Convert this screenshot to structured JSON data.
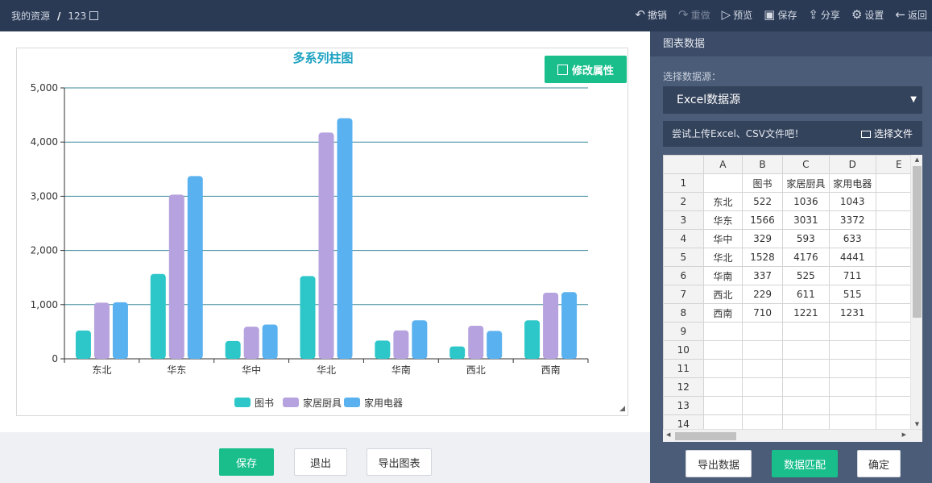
{
  "topbar": {
    "breadcrumb_root": "我的资源",
    "breadcrumb_sep": "/",
    "breadcrumb_item": "123",
    "actions": [
      {
        "label": "撤销",
        "icon": "undo-icon",
        "glyph": "↶",
        "disabled": false
      },
      {
        "label": "重做",
        "icon": "redo-icon",
        "glyph": "↷",
        "disabled": true
      },
      {
        "label": "预览",
        "icon": "play-icon",
        "glyph": "▷",
        "disabled": false
      },
      {
        "label": "保存",
        "icon": "save-icon",
        "glyph": "▣",
        "disabled": false
      },
      {
        "label": "分享",
        "icon": "share-icon",
        "glyph": "⇪",
        "disabled": false
      },
      {
        "label": "设置",
        "icon": "gear-icon",
        "glyph": "⚙",
        "disabled": false
      },
      {
        "label": "返回",
        "icon": "back-arrow-icon",
        "glyph": "←",
        "disabled": false
      }
    ]
  },
  "canvas": {
    "modify_button": "修改属性"
  },
  "chart_data": {
    "type": "bar",
    "title": "多系列柱图",
    "categories": [
      "东北",
      "华东",
      "华中",
      "华北",
      "华南",
      "西北",
      "西南"
    ],
    "series": [
      {
        "name": "图书",
        "color": "#2ec7c9",
        "values": [
          522,
          1566,
          329,
          1528,
          337,
          229,
          710
        ]
      },
      {
        "name": "家居厨具",
        "color": "#b6a2de",
        "values": [
          1036,
          3031,
          593,
          4176,
          525,
          611,
          1221
        ]
      },
      {
        "name": "家用电器",
        "color": "#5ab1ef",
        "values": [
          1043,
          3372,
          633,
          4441,
          711,
          515,
          1231
        ]
      }
    ],
    "ylim": [
      0,
      5000
    ],
    "yticks": [
      "0",
      "1,000",
      "2,000",
      "3,000",
      "4,000",
      "5,000"
    ],
    "grid": true,
    "legend_position": "bottom-center"
  },
  "bottom_bar": {
    "save": "保存",
    "exit": "退出",
    "export_chart": "导出图表"
  },
  "right_panel": {
    "header": "图表数据",
    "datasource_label": "选择数据源：",
    "datasource_value": "Excel数据源",
    "upload_hint": "尝试上传Excel、CSV文件吧！",
    "choose_file": "选择文件",
    "sheet": {
      "col_headers": [
        "A",
        "B",
        "C",
        "D",
        "E"
      ],
      "row_numbers": [
        "1",
        "2",
        "3",
        "4",
        "5",
        "6",
        "7",
        "8",
        "9",
        "10",
        "11",
        "12",
        "13",
        "14"
      ],
      "rows": [
        [
          "",
          "图书",
          "家居厨具",
          "家用电器",
          ""
        ],
        [
          "东北",
          "522",
          "1036",
          "1043",
          ""
        ],
        [
          "华东",
          "1566",
          "3031",
          "3372",
          ""
        ],
        [
          "华中",
          "329",
          "593",
          "633",
          ""
        ],
        [
          "华北",
          "1528",
          "4176",
          "4441",
          ""
        ],
        [
          "华南",
          "337",
          "525",
          "711",
          ""
        ],
        [
          "西北",
          "229",
          "611",
          "515",
          ""
        ],
        [
          "西南",
          "710",
          "1221",
          "1231",
          ""
        ],
        [
          "",
          "",
          "",
          "",
          ""
        ],
        [
          "",
          "",
          "",
          "",
          ""
        ],
        [
          "",
          "",
          "",
          "",
          ""
        ],
        [
          "",
          "",
          "",
          "",
          ""
        ],
        [
          "",
          "",
          "",
          "",
          ""
        ],
        [
          "",
          "",
          "",
          "",
          ""
        ]
      ]
    },
    "export_data": "导出数据",
    "data_match": "数据匹配",
    "confirm": "确定"
  }
}
